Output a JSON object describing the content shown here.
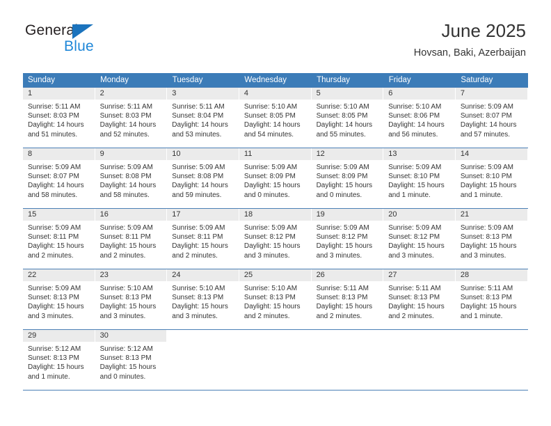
{
  "logo": {
    "line1": "General",
    "line2": "Blue",
    "triangle": "blue-triangle-icon",
    "color_dark": "#231f20",
    "color_blue": "#1f87d8"
  },
  "header": {
    "title": "June 2025",
    "subtitle": "Hovsan, Baki, Azerbaijan"
  },
  "theme": {
    "header_bg": "#3c7cb8",
    "header_text": "#ffffff",
    "daynum_bg": "#ebebeb",
    "row_divider": "#4a7fb5",
    "body_text": "#333333"
  },
  "weekdays": [
    "Sunday",
    "Monday",
    "Tuesday",
    "Wednesday",
    "Thursday",
    "Friday",
    "Saturday"
  ],
  "weeks": [
    [
      {
        "day": "1",
        "sunrise": "Sunrise: 5:11 AM",
        "sunset": "Sunset: 8:03 PM",
        "daylight1": "Daylight: 14 hours",
        "daylight2": "and 51 minutes."
      },
      {
        "day": "2",
        "sunrise": "Sunrise: 5:11 AM",
        "sunset": "Sunset: 8:03 PM",
        "daylight1": "Daylight: 14 hours",
        "daylight2": "and 52 minutes."
      },
      {
        "day": "3",
        "sunrise": "Sunrise: 5:11 AM",
        "sunset": "Sunset: 8:04 PM",
        "daylight1": "Daylight: 14 hours",
        "daylight2": "and 53 minutes."
      },
      {
        "day": "4",
        "sunrise": "Sunrise: 5:10 AM",
        "sunset": "Sunset: 8:05 PM",
        "daylight1": "Daylight: 14 hours",
        "daylight2": "and 54 minutes."
      },
      {
        "day": "5",
        "sunrise": "Sunrise: 5:10 AM",
        "sunset": "Sunset: 8:05 PM",
        "daylight1": "Daylight: 14 hours",
        "daylight2": "and 55 minutes."
      },
      {
        "day": "6",
        "sunrise": "Sunrise: 5:10 AM",
        "sunset": "Sunset: 8:06 PM",
        "daylight1": "Daylight: 14 hours",
        "daylight2": "and 56 minutes."
      },
      {
        "day": "7",
        "sunrise": "Sunrise: 5:09 AM",
        "sunset": "Sunset: 8:07 PM",
        "daylight1": "Daylight: 14 hours",
        "daylight2": "and 57 minutes."
      }
    ],
    [
      {
        "day": "8",
        "sunrise": "Sunrise: 5:09 AM",
        "sunset": "Sunset: 8:07 PM",
        "daylight1": "Daylight: 14 hours",
        "daylight2": "and 58 minutes."
      },
      {
        "day": "9",
        "sunrise": "Sunrise: 5:09 AM",
        "sunset": "Sunset: 8:08 PM",
        "daylight1": "Daylight: 14 hours",
        "daylight2": "and 58 minutes."
      },
      {
        "day": "10",
        "sunrise": "Sunrise: 5:09 AM",
        "sunset": "Sunset: 8:08 PM",
        "daylight1": "Daylight: 14 hours",
        "daylight2": "and 59 minutes."
      },
      {
        "day": "11",
        "sunrise": "Sunrise: 5:09 AM",
        "sunset": "Sunset: 8:09 PM",
        "daylight1": "Daylight: 15 hours",
        "daylight2": "and 0 minutes."
      },
      {
        "day": "12",
        "sunrise": "Sunrise: 5:09 AM",
        "sunset": "Sunset: 8:09 PM",
        "daylight1": "Daylight: 15 hours",
        "daylight2": "and 0 minutes."
      },
      {
        "day": "13",
        "sunrise": "Sunrise: 5:09 AM",
        "sunset": "Sunset: 8:10 PM",
        "daylight1": "Daylight: 15 hours",
        "daylight2": "and 1 minute."
      },
      {
        "day": "14",
        "sunrise": "Sunrise: 5:09 AM",
        "sunset": "Sunset: 8:10 PM",
        "daylight1": "Daylight: 15 hours",
        "daylight2": "and 1 minute."
      }
    ],
    [
      {
        "day": "15",
        "sunrise": "Sunrise: 5:09 AM",
        "sunset": "Sunset: 8:11 PM",
        "daylight1": "Daylight: 15 hours",
        "daylight2": "and 2 minutes."
      },
      {
        "day": "16",
        "sunrise": "Sunrise: 5:09 AM",
        "sunset": "Sunset: 8:11 PM",
        "daylight1": "Daylight: 15 hours",
        "daylight2": "and 2 minutes."
      },
      {
        "day": "17",
        "sunrise": "Sunrise: 5:09 AM",
        "sunset": "Sunset: 8:11 PM",
        "daylight1": "Daylight: 15 hours",
        "daylight2": "and 2 minutes."
      },
      {
        "day": "18",
        "sunrise": "Sunrise: 5:09 AM",
        "sunset": "Sunset: 8:12 PM",
        "daylight1": "Daylight: 15 hours",
        "daylight2": "and 3 minutes."
      },
      {
        "day": "19",
        "sunrise": "Sunrise: 5:09 AM",
        "sunset": "Sunset: 8:12 PM",
        "daylight1": "Daylight: 15 hours",
        "daylight2": "and 3 minutes."
      },
      {
        "day": "20",
        "sunrise": "Sunrise: 5:09 AM",
        "sunset": "Sunset: 8:12 PM",
        "daylight1": "Daylight: 15 hours",
        "daylight2": "and 3 minutes."
      },
      {
        "day": "21",
        "sunrise": "Sunrise: 5:09 AM",
        "sunset": "Sunset: 8:13 PM",
        "daylight1": "Daylight: 15 hours",
        "daylight2": "and 3 minutes."
      }
    ],
    [
      {
        "day": "22",
        "sunrise": "Sunrise: 5:09 AM",
        "sunset": "Sunset: 8:13 PM",
        "daylight1": "Daylight: 15 hours",
        "daylight2": "and 3 minutes."
      },
      {
        "day": "23",
        "sunrise": "Sunrise: 5:10 AM",
        "sunset": "Sunset: 8:13 PM",
        "daylight1": "Daylight: 15 hours",
        "daylight2": "and 3 minutes."
      },
      {
        "day": "24",
        "sunrise": "Sunrise: 5:10 AM",
        "sunset": "Sunset: 8:13 PM",
        "daylight1": "Daylight: 15 hours",
        "daylight2": "and 3 minutes."
      },
      {
        "day": "25",
        "sunrise": "Sunrise: 5:10 AM",
        "sunset": "Sunset: 8:13 PM",
        "daylight1": "Daylight: 15 hours",
        "daylight2": "and 2 minutes."
      },
      {
        "day": "26",
        "sunrise": "Sunrise: 5:11 AM",
        "sunset": "Sunset: 8:13 PM",
        "daylight1": "Daylight: 15 hours",
        "daylight2": "and 2 minutes."
      },
      {
        "day": "27",
        "sunrise": "Sunrise: 5:11 AM",
        "sunset": "Sunset: 8:13 PM",
        "daylight1": "Daylight: 15 hours",
        "daylight2": "and 2 minutes."
      },
      {
        "day": "28",
        "sunrise": "Sunrise: 5:11 AM",
        "sunset": "Sunset: 8:13 PM",
        "daylight1": "Daylight: 15 hours",
        "daylight2": "and 1 minute."
      }
    ],
    [
      {
        "day": "29",
        "sunrise": "Sunrise: 5:12 AM",
        "sunset": "Sunset: 8:13 PM",
        "daylight1": "Daylight: 15 hours",
        "daylight2": "and 1 minute."
      },
      {
        "day": "30",
        "sunrise": "Sunrise: 5:12 AM",
        "sunset": "Sunset: 8:13 PM",
        "daylight1": "Daylight: 15 hours",
        "daylight2": "and 0 minutes."
      },
      {
        "day": "",
        "sunrise": "",
        "sunset": "",
        "daylight1": "",
        "daylight2": ""
      },
      {
        "day": "",
        "sunrise": "",
        "sunset": "",
        "daylight1": "",
        "daylight2": ""
      },
      {
        "day": "",
        "sunrise": "",
        "sunset": "",
        "daylight1": "",
        "daylight2": ""
      },
      {
        "day": "",
        "sunrise": "",
        "sunset": "",
        "daylight1": "",
        "daylight2": ""
      },
      {
        "day": "",
        "sunrise": "",
        "sunset": "",
        "daylight1": "",
        "daylight2": ""
      }
    ]
  ]
}
